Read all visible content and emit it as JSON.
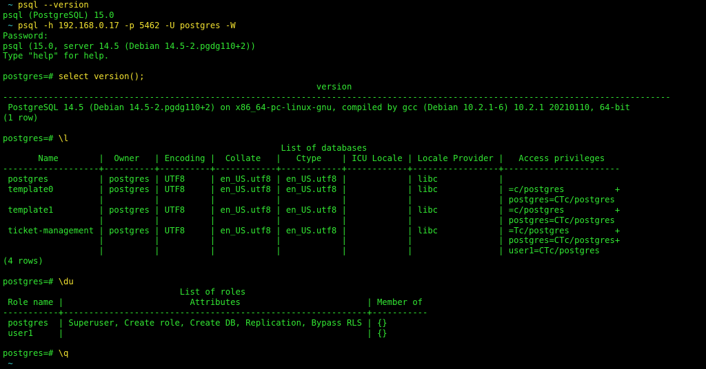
{
  "colors": {
    "background": "#000000",
    "output_green": "#32e632",
    "command_yellow": "#f0e030",
    "prompt_cyan": "#37c8c8"
  },
  "shell_prompt": {
    "glyph": "",
    "tilde": "~"
  },
  "lines": [
    {
      "type": "shell",
      "cmd": "psql --version"
    },
    {
      "type": "out",
      "text": "psql (PostgreSQL) 15.0"
    },
    {
      "type": "shell",
      "cmd": "psql -h 192.168.0.17 -p 5462 -U postgres -W"
    },
    {
      "type": "out",
      "text": "Password:"
    },
    {
      "type": "out",
      "text": "psql (15.0, server 14.5 (Debian 14.5-2.pgdg110+2))"
    },
    {
      "type": "out",
      "text": "Type \"help\" for help."
    },
    {
      "type": "out",
      "text": ""
    },
    {
      "type": "sql",
      "prompt": "postgres=# ",
      "cmd": "select version();"
    },
    {
      "type": "out",
      "text": "                                                              version"
    },
    {
      "type": "out",
      "text": "------------------------------------------------------------------------------------------------------------------------------------"
    },
    {
      "type": "out",
      "text": " PostgreSQL 14.5 (Debian 14.5-2.pgdg110+2) on x86_64-pc-linux-gnu, compiled by gcc (Debian 10.2.1-6) 10.2.1 20210110, 64-bit"
    },
    {
      "type": "out",
      "text": "(1 row)"
    },
    {
      "type": "out",
      "text": ""
    },
    {
      "type": "sql",
      "prompt": "postgres=# ",
      "cmd": "\\l"
    },
    {
      "type": "out",
      "text": "                                                       List of databases"
    },
    {
      "type": "out",
      "text": "       Name        |  Owner   | Encoding |  Collate   |   Ctype    | ICU Locale | Locale Provider |   Access privileges"
    },
    {
      "type": "out",
      "text": "-------------------+----------+----------+------------+------------+------------+-----------------+-----------------------"
    },
    {
      "type": "out",
      "text": " postgres          | postgres | UTF8     | en_US.utf8 | en_US.utf8 |            | libc            |"
    },
    {
      "type": "out",
      "text": " template0         | postgres | UTF8     | en_US.utf8 | en_US.utf8 |            | libc            | =c/postgres          +"
    },
    {
      "type": "out",
      "text": "                   |          |          |            |            |            |                 | postgres=CTc/postgres"
    },
    {
      "type": "out",
      "text": " template1         | postgres | UTF8     | en_US.utf8 | en_US.utf8 |            | libc            | =c/postgres          +"
    },
    {
      "type": "out",
      "text": "                   |          |          |            |            |            |                 | postgres=CTc/postgres"
    },
    {
      "type": "out",
      "text": " ticket-management | postgres | UTF8     | en_US.utf8 | en_US.utf8 |            | libc            | =Tc/postgres         +"
    },
    {
      "type": "out",
      "text": "                   |          |          |            |            |            |                 | postgres=CTc/postgres+"
    },
    {
      "type": "out",
      "text": "                   |          |          |            |            |            |                 | user1=CTc/postgres"
    },
    {
      "type": "out",
      "text": "(4 rows)"
    },
    {
      "type": "out",
      "text": ""
    },
    {
      "type": "sql",
      "prompt": "postgres=# ",
      "cmd": "\\du"
    },
    {
      "type": "out",
      "text": "                                   List of roles"
    },
    {
      "type": "out",
      "text": " Role name |                         Attributes                         | Member of"
    },
    {
      "type": "out",
      "text": "-----------+------------------------------------------------------------+-----------"
    },
    {
      "type": "out",
      "text": " postgres  | Superuser, Create role, Create DB, Replication, Bypass RLS | {}"
    },
    {
      "type": "out",
      "text": " user1     |                                                            | {}"
    },
    {
      "type": "out",
      "text": ""
    },
    {
      "type": "sql",
      "prompt": "postgres=# ",
      "cmd": "\\q"
    },
    {
      "type": "shell",
      "cmd": ""
    }
  ]
}
